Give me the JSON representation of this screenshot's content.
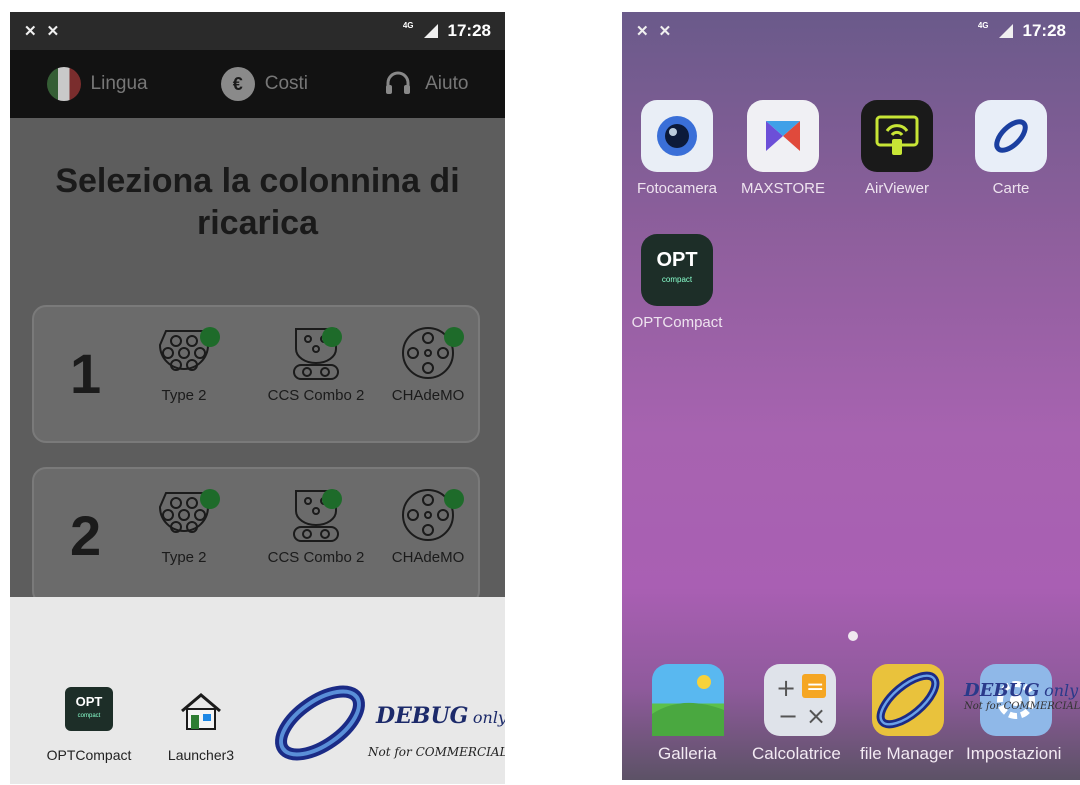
{
  "left_screen": {
    "status_bar": {
      "time": "17:28",
      "network": "4G"
    },
    "top_nav": [
      {
        "label": "Lingua",
        "icon": "italy-flag-icon"
      },
      {
        "label": "Costi",
        "icon": "euro-icon",
        "glyph": "€"
      },
      {
        "label": "Aiuto",
        "icon": "headset-icon"
      }
    ],
    "title": "Seleziona la colonnina di ricarica",
    "stations": [
      {
        "number": "1",
        "connectors": [
          {
            "label": "Type 2",
            "status_color": "#1e6b2a"
          },
          {
            "label": "CCS Combo 2",
            "status_color": "#1e6b2a"
          },
          {
            "label": "CHAdeMO",
            "status_color": "#1e6b2a"
          }
        ]
      },
      {
        "number": "2",
        "connectors": [
          {
            "label": "Type 2",
            "status_color": "#1e6b2a"
          },
          {
            "label": "CCS Combo 2",
            "status_color": "#1e6b2a"
          },
          {
            "label": "CHAdeMO",
            "status_color": "#1e6b2a"
          }
        ]
      }
    ],
    "taskbar_apps": [
      {
        "label": "OPTCompact",
        "tile_text": "OPT",
        "tile_sub": "compact"
      },
      {
        "label": "Launcher3"
      }
    ],
    "watermark": {
      "text": "DEBUG",
      "suffix": "only",
      "subtext": "Not for COMMERCIAL"
    }
  },
  "right_screen": {
    "status_bar": {
      "time": "17:28",
      "network": "4G"
    },
    "apps": [
      {
        "label": "Fotocamera",
        "icon": "camera-icon"
      },
      {
        "label": "MAXSTORE",
        "icon": "maxstore-icon"
      },
      {
        "label": "AirViewer",
        "icon": "airviewer-icon"
      },
      {
        "label": "Carte",
        "icon": "cards-icon"
      },
      {
        "label": "OPTCompact",
        "icon": "opt-icon",
        "tile_text": "OPT",
        "tile_sub": "compact"
      }
    ],
    "dock": [
      {
        "label": "Galleria",
        "icon": "gallery-icon"
      },
      {
        "label": "Calcolatrice",
        "icon": "calculator-icon"
      },
      {
        "label": "file Manager",
        "icon": "file-manager-icon"
      },
      {
        "label": "Impostazioni",
        "icon": "settings-icon"
      }
    ],
    "watermark": {
      "text": "DEBUG",
      "suffix": "only",
      "subtext": "Not for COMMERCIAL"
    }
  }
}
